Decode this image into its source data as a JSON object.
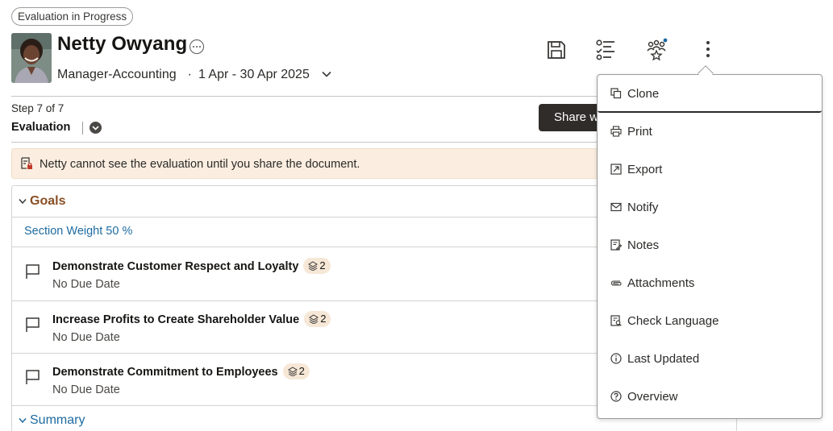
{
  "status": "Evaluation in Progress",
  "person": {
    "name": "Netty Owyang",
    "role": "Manager-Accounting",
    "period": "1 Apr - 30 Apr 2025"
  },
  "step": {
    "counter": "Step 7 of 7",
    "title": "Evaluation"
  },
  "share_button": "Share w",
  "banner": {
    "text": "Netty cannot see the evaluation until you share the document."
  },
  "goals_section": {
    "title": "Goals",
    "weight": "Section Weight 50 %",
    "items": [
      {
        "title": "Demonstrate Customer Respect and Loyalty",
        "count": "2",
        "due": "No Due Date"
      },
      {
        "title": "Increase Profits to Create Shareholder Value",
        "count": "2",
        "due": "No Due Date"
      },
      {
        "title": "Demonstrate Commitment to Employees",
        "count": "2",
        "due": "No Due Date"
      }
    ]
  },
  "summary_section": {
    "title": "Summary"
  },
  "menu": {
    "items": [
      {
        "label": "Clone",
        "icon": "clone-icon"
      },
      {
        "label": "Print",
        "icon": "print-icon"
      },
      {
        "label": "Export",
        "icon": "export-icon"
      },
      {
        "label": "Notify",
        "icon": "mail-icon"
      },
      {
        "label": "Notes",
        "icon": "notes-icon"
      },
      {
        "label": "Attachments",
        "icon": "paperclip-icon"
      },
      {
        "label": "Check Language",
        "icon": "check-language-icon"
      },
      {
        "label": "Last Updated",
        "icon": "info-icon"
      },
      {
        "label": "Overview",
        "icon": "help-icon"
      }
    ]
  },
  "colors": {
    "goals_heading": "#8a4f25",
    "link_blue": "#1e6ba1",
    "banner_bg": "#fbeee0",
    "notification_dot": "#1e6ba1"
  }
}
